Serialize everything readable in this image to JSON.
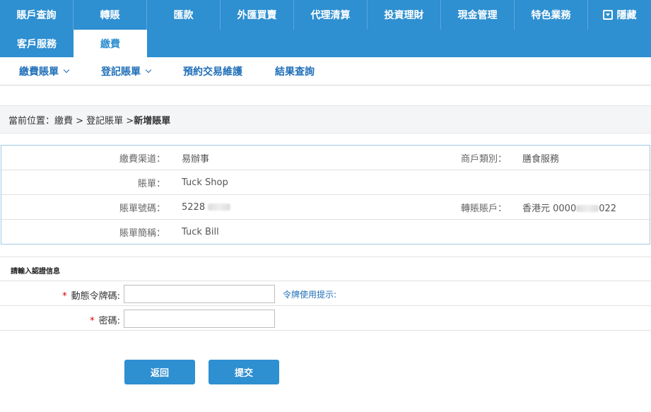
{
  "nav": {
    "row1": [
      "賬戶查詢",
      "轉賬",
      "匯款",
      "外匯買賣",
      "代理清算",
      "投資理財",
      "現金管理",
      "特色業務"
    ],
    "hide_label": "隱藏",
    "row2": [
      "客戶服務",
      "繳費"
    ]
  },
  "subnav": {
    "items": [
      "繳費賬單",
      "登記賬單",
      "預約交易維護",
      "結果查詢"
    ]
  },
  "breadcrumb": {
    "prefix": "當前位置：繳費 > 登記賬單 > ",
    "current": "新增賬單"
  },
  "info": {
    "channel_label": "繳費渠道：",
    "channel_value": "易辦事",
    "merchant_type_label": "商戶類別：",
    "merchant_type_value": "膳食服務",
    "bill_label": "賬單：",
    "bill_value": "Tuck Shop",
    "bill_number_label": "賬單號碼：",
    "bill_number_value": "5228",
    "transfer_account_label": "轉賬賬戶：",
    "transfer_account_prefix": "香港元 0000",
    "transfer_account_suffix": "022",
    "bill_short_label": "賬單簡稱：",
    "bill_short_value": "Tuck Bill"
  },
  "auth": {
    "title": "請輸入認證信息",
    "token_label": "動態令牌碼:",
    "token_hint": "令牌使用提示:",
    "password_label": "密碼:",
    "token_value": "",
    "password_value": ""
  },
  "buttons": {
    "back": "返回",
    "submit": "提交"
  }
}
